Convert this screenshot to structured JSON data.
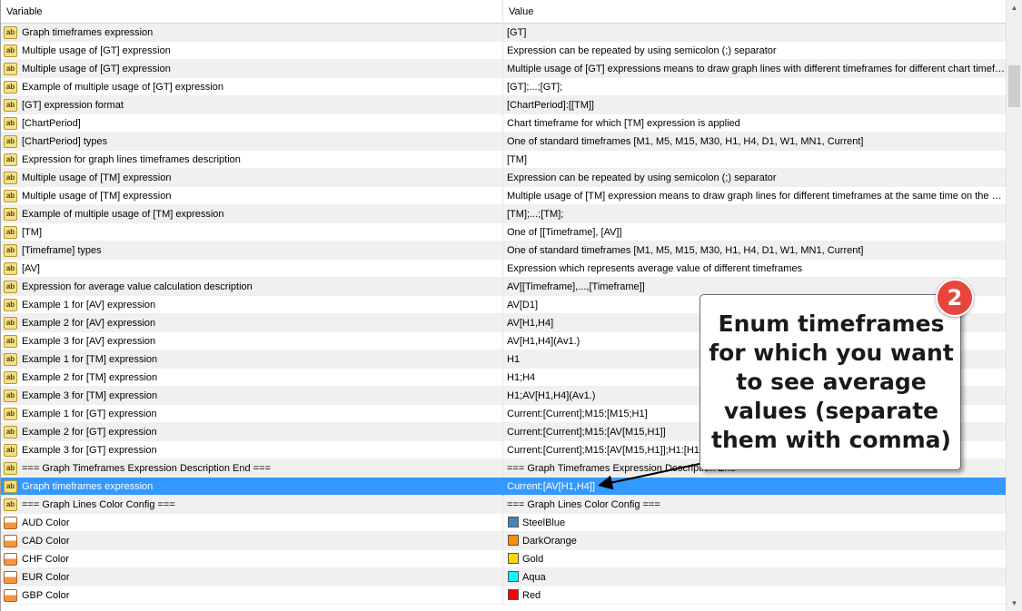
{
  "header": {
    "variable": "Variable",
    "value": "Value"
  },
  "rows": [
    {
      "variable": "Graph timeframes expression",
      "value": "[GT]",
      "icon": "ab"
    },
    {
      "variable": "Multiple usage of [GT] expression",
      "value": "Expression can be repeated by using semicolon (;) separator",
      "icon": "ab"
    },
    {
      "variable": "Multiple usage of [GT] expression",
      "value": "Multiple usage of [GT] expressions means to draw graph lines with different timeframes for different chart timeframes",
      "icon": "ab"
    },
    {
      "variable": "Example of multiple usage of [GT] expression",
      "value": "[GT];...;[GT];",
      "icon": "ab"
    },
    {
      "variable": "[GT] expression format",
      "value": "[ChartPeriod]:[[TM]]",
      "icon": "ab"
    },
    {
      "variable": "[ChartPeriod]",
      "value": "Chart timeframe for which [TM] expression is applied",
      "icon": "ab"
    },
    {
      "variable": "[ChartPeriod] types",
      "value": "One of standard timeframes [M1, M5, M15, M30, H1, H4, D1, W1, MN1, Current]",
      "icon": "ab"
    },
    {
      "variable": "Expression for graph lines timeframes description",
      "value": "[TM]",
      "icon": "ab"
    },
    {
      "variable": "Multiple usage of [TM] expression",
      "value": "Expression can be repeated by using semicolon (;) separator",
      "icon": "ab"
    },
    {
      "variable": "Multiple usage of [TM] expression",
      "value": "Multiple usage of [TM] expression means to draw graph lines for different timeframes at the same time on the current chart",
      "icon": "ab"
    },
    {
      "variable": "Example of multiple usage of [TM] expression",
      "value": "[TM];...;[TM];",
      "icon": "ab"
    },
    {
      "variable": "[TM]",
      "value": "One of [[Timeframe], [AV]]",
      "icon": "ab"
    },
    {
      "variable": "[Timeframe] types",
      "value": "One of standard timeframes [M1, M5, M15, M30, H1, H4, D1, W1, MN1, Current]",
      "icon": "ab"
    },
    {
      "variable": "[AV]",
      "value": "Expression which represents average value of different timeframes",
      "icon": "ab"
    },
    {
      "variable": "Expression for average value calculation description",
      "value": "AV[[Timeframe],...,[Timeframe]]",
      "icon": "ab"
    },
    {
      "variable": "Example 1 for [AV] expression",
      "value": "AV[D1]",
      "icon": "ab"
    },
    {
      "variable": "Example 2 for [AV] expression",
      "value": "AV[H1,H4]",
      "icon": "ab"
    },
    {
      "variable": "Example 3 for [AV] expression",
      "value": "AV[H1,H4](Av1.)",
      "icon": "ab"
    },
    {
      "variable": "Example 1 for [TM] expression",
      "value": "H1",
      "icon": "ab"
    },
    {
      "variable": "Example 2 for [TM] expression",
      "value": "H1;H4",
      "icon": "ab"
    },
    {
      "variable": "Example 3 for [TM] expression",
      "value": "H1;AV[H1,H4](Av1.)",
      "icon": "ab"
    },
    {
      "variable": "Example 1 for [GT] expression",
      "value": "Current:[Current];M15:[M15;H1]",
      "icon": "ab"
    },
    {
      "variable": "Example 2 for [GT] expression",
      "value": "Current:[Current];M15:[AV[M15,H1]]",
      "icon": "ab"
    },
    {
      "variable": "Example 3 for [GT] expression",
      "value": "Current:[Current];M15:[AV[M15,H1]];H1:[H1;...]",
      "icon": "ab"
    },
    {
      "variable": "=== Graph Timeframes Expression Description End ===",
      "value": "=== Graph Timeframes Expression Description End ===",
      "icon": "ab"
    },
    {
      "variable": "Graph timeframes expression",
      "value": "Current:[AV[H1,H4]]",
      "icon": "ab",
      "selected": true
    },
    {
      "variable": "=== Graph Lines Color Config ===",
      "value": "=== Graph Lines Color Config ===",
      "icon": "ab"
    },
    {
      "variable": "AUD Color",
      "value": "SteelBlue",
      "icon": "color",
      "swatch": "#4682b4"
    },
    {
      "variable": "CAD Color",
      "value": "DarkOrange",
      "icon": "color",
      "swatch": "#ff8c00"
    },
    {
      "variable": "CHF Color",
      "value": "Gold",
      "icon": "color",
      "swatch": "#ffd700"
    },
    {
      "variable": "EUR Color",
      "value": "Aqua",
      "icon": "color",
      "swatch": "#00ffff"
    },
    {
      "variable": "GBP Color",
      "value": "Red",
      "icon": "color",
      "swatch": "#ff0000"
    }
  ],
  "callout": {
    "badge": "2",
    "lines": [
      "Enum timeframes",
      "for which you want",
      "to see average",
      "values (separate",
      "them with comma)"
    ]
  },
  "scrollbar": {
    "up": "▲",
    "down": "▼"
  },
  "colors": {
    "selection": "#3399ff",
    "badge": "#e8453c"
  }
}
